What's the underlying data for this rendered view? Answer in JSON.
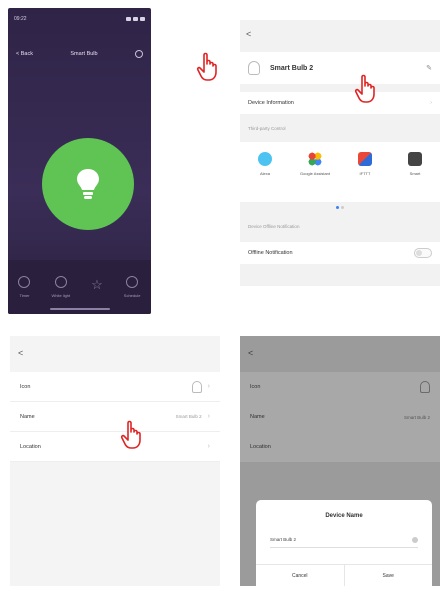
{
  "panel1": {
    "status_time": "09:22",
    "back_label": "< Back",
    "title": "Smart Bulb",
    "tabs": [
      {
        "label": "Timer"
      },
      {
        "label": "White light"
      },
      {
        "label": ""
      },
      {
        "label": "Schedule"
      }
    ],
    "colors": {
      "bulb_on": "#5fc453",
      "background": "#2f2447"
    }
  },
  "panel2": {
    "back_label": "<",
    "device_name": "Smart Bulb 2",
    "device_information_label": "Device Information",
    "third_party_label": "Third-party Control",
    "tiles": [
      {
        "label": "Alexa",
        "color": "#4cc3f0"
      },
      {
        "label": "Google Assistant",
        "color": "#4285f4"
      },
      {
        "label": "IFTTT",
        "color": "#e8473a"
      },
      {
        "label": "Smart",
        "color": "#444444"
      }
    ],
    "offline_section_label": "Device Offline Notification",
    "offline_label": "Offline Notification"
  },
  "panel3": {
    "back_label": "<",
    "rows": [
      {
        "label": "Icon",
        "value": ""
      },
      {
        "label": "Name",
        "value": "Smart Bulb 2"
      },
      {
        "label": "Location",
        "value": ""
      }
    ]
  },
  "panel4": {
    "back_label": "<",
    "rows": [
      {
        "label": "Icon",
        "value": ""
      },
      {
        "label": "Name",
        "value": "Smart Bulb 2"
      },
      {
        "label": "Location",
        "value": ""
      }
    ],
    "dialog": {
      "title": "Device Name",
      "value": "Smart Bulb 2",
      "cancel_label": "Cancel",
      "save_label": "Save"
    }
  }
}
